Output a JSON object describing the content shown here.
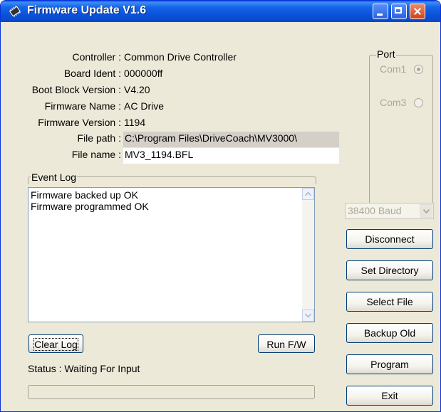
{
  "window": {
    "title": "Firmware Update V1.6",
    "icon": "chip-icon",
    "controls": [
      "minimize-icon",
      "maximize-icon",
      "close-icon"
    ]
  },
  "info": {
    "controller_label": "Controller :",
    "controller_value": "Common Drive Controller",
    "board_label": "Board Ident :",
    "board_value": "000000ff",
    "bootblock_label": "Boot Block Version :",
    "bootblock_value": "V4.20",
    "fwname_label": "Firmware Name :",
    "fwname_value": "AC Drive",
    "fwversion_label": "Firmware Version :",
    "fwversion_value": "1194",
    "filepath_label": "File path :",
    "filepath_value": "C:\\Program Files\\DriveCoach\\MV3000\\",
    "filename_label": "File name :",
    "filename_value": "MV3_1194.BFL"
  },
  "event_log": {
    "title": "Event Log",
    "lines": [
      "Firmware backed up OK",
      "Firmware programmed OK"
    ]
  },
  "buttons": {
    "clear_log": "Clear Log",
    "run_fw": "Run F/W",
    "disconnect": "Disconnect",
    "set_directory": "Set Directory",
    "select_file": "Select File",
    "backup_old": "Backup Old",
    "program": "Program",
    "exit": "Exit"
  },
  "status": {
    "text": "Status : Waiting For Input",
    "progress": 0
  },
  "port": {
    "title": "Port",
    "options": [
      {
        "label": "Com1",
        "selected": true
      },
      {
        "label": "Com3",
        "selected": false
      }
    ]
  },
  "baud": {
    "selected": "38400 Baud"
  },
  "colors": {
    "titlebar": "#0a50d8",
    "window_bg": "#ece9d8",
    "disabled_text": "#aca899"
  }
}
